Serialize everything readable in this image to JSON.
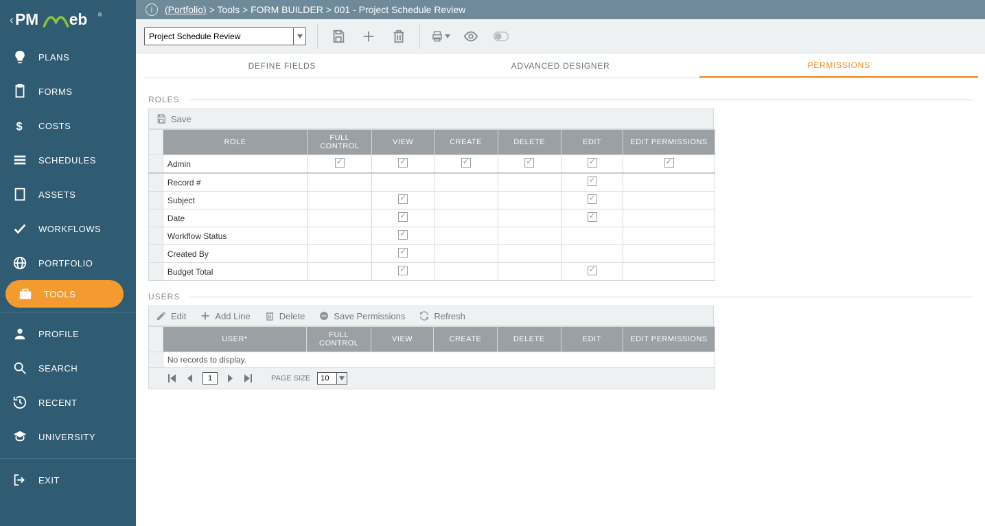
{
  "sidebar": {
    "items": [
      {
        "label": "PLANS",
        "icon": "bulb-icon"
      },
      {
        "label": "FORMS",
        "icon": "clipboard-icon"
      },
      {
        "label": "COSTS",
        "icon": "dollar-icon"
      },
      {
        "label": "SCHEDULES",
        "icon": "bars-icon"
      },
      {
        "label": "ASSETS",
        "icon": "building-icon"
      },
      {
        "label": "WORKFLOWS",
        "icon": "check-icon"
      },
      {
        "label": "PORTFOLIO",
        "icon": "globe-icon"
      },
      {
        "label": "TOOLS",
        "icon": "briefcase-icon",
        "active": true
      }
    ],
    "lower": [
      {
        "label": "PROFILE",
        "icon": "user-icon"
      },
      {
        "label": "SEARCH",
        "icon": "search-icon"
      },
      {
        "label": "RECENT",
        "icon": "history-icon"
      },
      {
        "label": "UNIVERSITY",
        "icon": "grad-icon"
      }
    ],
    "exit": {
      "label": "EXIT",
      "icon": "exit-icon"
    }
  },
  "breadcrumb": {
    "root": "(Portfolio)",
    "parts": [
      "Tools",
      "FORM BUILDER",
      "001 - Project Schedule Review"
    ],
    "sep": ">"
  },
  "toolbar": {
    "selector_value": "Project Schedule Review"
  },
  "tabs": [
    {
      "label": "DEFINE FIELDS"
    },
    {
      "label": "ADVANCED DESIGNER"
    },
    {
      "label": "PERMISSIONS",
      "active": true
    }
  ],
  "roles_section": {
    "title": "ROLES",
    "save_label": "Save",
    "columns": [
      "ROLE",
      "FULL CONTROL",
      "VIEW",
      "CREATE",
      "DELETE",
      "EDIT",
      "EDIT PERMISSIONS"
    ],
    "rows": [
      {
        "role": "Admin",
        "full": true,
        "view": true,
        "create": true,
        "delete": true,
        "edit": true,
        "editperm": true,
        "admin": true
      },
      {
        "role": "Record #",
        "full": false,
        "view": false,
        "create": false,
        "delete": false,
        "edit": true,
        "editperm": false
      },
      {
        "role": "Subject",
        "full": false,
        "view": true,
        "create": false,
        "delete": false,
        "edit": true,
        "editperm": false
      },
      {
        "role": "Date",
        "full": false,
        "view": true,
        "create": false,
        "delete": false,
        "edit": true,
        "editperm": false
      },
      {
        "role": "Workflow Status",
        "full": false,
        "view": true,
        "create": false,
        "delete": false,
        "edit": false,
        "editperm": false
      },
      {
        "role": "Created By",
        "full": false,
        "view": true,
        "create": false,
        "delete": false,
        "edit": false,
        "editperm": false
      },
      {
        "role": "Budget Total",
        "full": false,
        "view": true,
        "create": false,
        "delete": false,
        "edit": true,
        "editperm": false
      }
    ]
  },
  "users_section": {
    "title": "USERS",
    "buttons": {
      "edit": "Edit",
      "add": "Add Line",
      "delete": "Delete",
      "save": "Save Permissions",
      "refresh": "Refresh"
    },
    "columns": [
      "USER*",
      "FULL CONTROL",
      "VIEW",
      "CREATE",
      "DELETE",
      "EDIT",
      "EDIT PERMISSIONS"
    ],
    "empty": "No records to display."
  },
  "pager": {
    "page": "1",
    "page_size_label": "PAGE SIZE",
    "page_size": "10"
  }
}
